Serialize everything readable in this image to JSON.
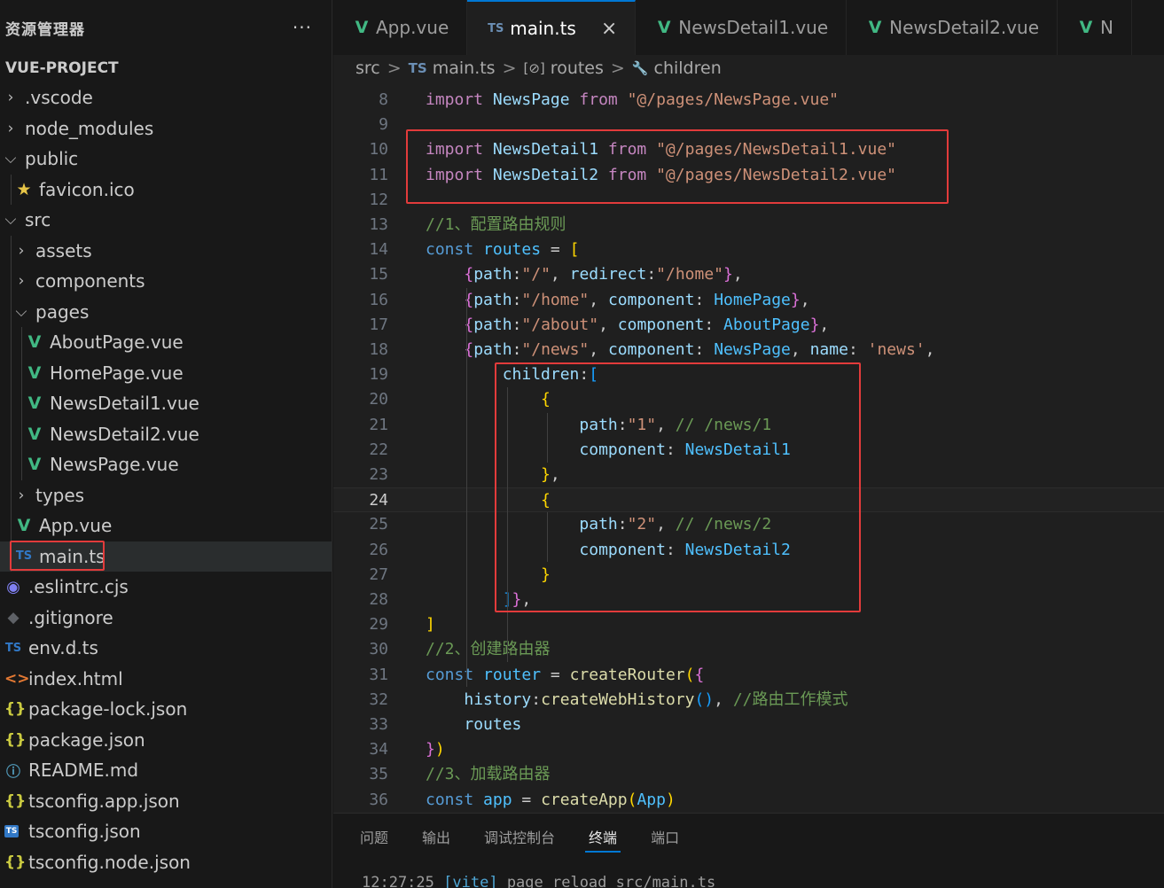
{
  "sidebar": {
    "title": "资源管理器",
    "more": "···",
    "project": "VUE-PROJECT",
    "items": [
      {
        "label": ".vscode",
        "depth": 0,
        "kind": "folder",
        "open": false
      },
      {
        "label": "node_modules",
        "depth": 0,
        "kind": "folder",
        "open": false
      },
      {
        "label": "public",
        "depth": 0,
        "kind": "folder",
        "open": true
      },
      {
        "label": "favicon.ico",
        "depth": 1,
        "kind": "file",
        "icon": "star"
      },
      {
        "label": "src",
        "depth": 0,
        "kind": "folder",
        "open": true
      },
      {
        "label": "assets",
        "depth": 1,
        "kind": "folder",
        "open": false
      },
      {
        "label": "components",
        "depth": 1,
        "kind": "folder",
        "open": false
      },
      {
        "label": "pages",
        "depth": 1,
        "kind": "folder",
        "open": true
      },
      {
        "label": "AboutPage.vue",
        "depth": 2,
        "kind": "file",
        "icon": "vue"
      },
      {
        "label": "HomePage.vue",
        "depth": 2,
        "kind": "file",
        "icon": "vue"
      },
      {
        "label": "NewsDetail1.vue",
        "depth": 2,
        "kind": "file",
        "icon": "vue"
      },
      {
        "label": "NewsDetail2.vue",
        "depth": 2,
        "kind": "file",
        "icon": "vue"
      },
      {
        "label": "NewsPage.vue",
        "depth": 2,
        "kind": "file",
        "icon": "vue"
      },
      {
        "label": "types",
        "depth": 1,
        "kind": "folder",
        "open": false
      },
      {
        "label": "App.vue",
        "depth": 1,
        "kind": "file",
        "icon": "vue"
      },
      {
        "label": "main.ts",
        "depth": 1,
        "kind": "file",
        "icon": "ts",
        "selected": true
      },
      {
        "label": ".eslintrc.cjs",
        "depth": 0,
        "kind": "file",
        "icon": "eslint"
      },
      {
        "label": ".gitignore",
        "depth": 0,
        "kind": "file",
        "icon": "git"
      },
      {
        "label": "env.d.ts",
        "depth": 0,
        "kind": "file",
        "icon": "ts"
      },
      {
        "label": "index.html",
        "depth": 0,
        "kind": "file",
        "icon": "html"
      },
      {
        "label": "package-lock.json",
        "depth": 0,
        "kind": "file",
        "icon": "json"
      },
      {
        "label": "package.json",
        "depth": 0,
        "kind": "file",
        "icon": "json"
      },
      {
        "label": "README.md",
        "depth": 0,
        "kind": "file",
        "icon": "info"
      },
      {
        "label": "tsconfig.app.json",
        "depth": 0,
        "kind": "file",
        "icon": "json"
      },
      {
        "label": "tsconfig.json",
        "depth": 0,
        "kind": "file",
        "icon": "tsconf"
      },
      {
        "label": "tsconfig.node.json",
        "depth": 0,
        "kind": "file",
        "icon": "json"
      }
    ]
  },
  "icons": {
    "vue": "V",
    "ts": "TS",
    "json": "{}",
    "html": "<>",
    "star": "★",
    "eslint": "◉",
    "git": "◆",
    "info": "ⓘ",
    "tsconf": "TS"
  },
  "tabs": [
    {
      "label": "App.vue",
      "icon": "vue",
      "active": false
    },
    {
      "label": "main.ts",
      "icon": "ts",
      "active": true
    },
    {
      "label": "NewsDetail1.vue",
      "icon": "vue",
      "active": false
    },
    {
      "label": "NewsDetail2.vue",
      "icon": "vue",
      "active": false
    },
    {
      "label": "N",
      "icon": "vue",
      "active": false
    }
  ],
  "tab_close": "×",
  "breadcrumb": {
    "src": "src",
    "file_icon": "TS",
    "file": "main.ts",
    "routes_icon": "[⊘]",
    "routes": "routes",
    "children_icon": "🔧",
    "children": "children",
    "sep": ">"
  },
  "code": {
    "current_line": 24,
    "lines": [
      {
        "n": 8,
        "t": [
          [
            "imp",
            "import "
          ],
          [
            "ident",
            "NewsPage "
          ],
          [
            "imp",
            "from "
          ],
          [
            "str",
            "\"@/pages/NewsPage.vue\""
          ]
        ]
      },
      {
        "n": 9,
        "t": []
      },
      {
        "n": 10,
        "t": [
          [
            "imp",
            "import "
          ],
          [
            "ident",
            "NewsDetail1 "
          ],
          [
            "imp",
            "from "
          ],
          [
            "str",
            "\"@/pages/NewsDetail1.vue\""
          ]
        ]
      },
      {
        "n": 11,
        "t": [
          [
            "imp",
            "import "
          ],
          [
            "ident",
            "NewsDetail2 "
          ],
          [
            "imp",
            "from "
          ],
          [
            "str",
            "\"@/pages/NewsDetail2.vue\""
          ]
        ]
      },
      {
        "n": 12,
        "t": []
      },
      {
        "n": 13,
        "t": [
          [
            "com",
            "//1、配置路由规则"
          ]
        ]
      },
      {
        "n": 14,
        "t": [
          [
            "kw",
            "const "
          ],
          [
            "var",
            "routes "
          ],
          [
            "",
            "= "
          ],
          [
            "b1",
            "["
          ]
        ]
      },
      {
        "n": 15,
        "t": [
          [
            "",
            "    "
          ],
          [
            "b2",
            "{"
          ],
          [
            "ident",
            "path"
          ],
          [
            "",
            ":"
          ],
          [
            "str",
            "\"/\""
          ],
          [
            "",
            ", "
          ],
          [
            "ident",
            "redirect"
          ],
          [
            "",
            ":"
          ],
          [
            "str",
            "\"/home\""
          ],
          [
            "b2",
            "}"
          ],
          [
            "",
            ","
          ]
        ]
      },
      {
        "n": 16,
        "t": [
          [
            "",
            "    "
          ],
          [
            "b2",
            "{"
          ],
          [
            "ident",
            "path"
          ],
          [
            "",
            ":"
          ],
          [
            "str",
            "\"/home\""
          ],
          [
            "",
            ", "
          ],
          [
            "ident",
            "component"
          ],
          [
            "",
            ": "
          ],
          [
            "var",
            "HomePage"
          ],
          [
            "b2",
            "}"
          ],
          [
            "",
            ","
          ]
        ]
      },
      {
        "n": 17,
        "t": [
          [
            "",
            "    "
          ],
          [
            "b2",
            "{"
          ],
          [
            "ident",
            "path"
          ],
          [
            "",
            ":"
          ],
          [
            "str",
            "\"/about\""
          ],
          [
            "",
            ", "
          ],
          [
            "ident",
            "component"
          ],
          [
            "",
            ": "
          ],
          [
            "var",
            "AboutPage"
          ],
          [
            "b2",
            "}"
          ],
          [
            "",
            ","
          ]
        ]
      },
      {
        "n": 18,
        "t": [
          [
            "",
            "    "
          ],
          [
            "b2",
            "{"
          ],
          [
            "ident",
            "path"
          ],
          [
            "",
            ":"
          ],
          [
            "str",
            "\"/news\""
          ],
          [
            "",
            ", "
          ],
          [
            "ident",
            "component"
          ],
          [
            "",
            ": "
          ],
          [
            "var",
            "NewsPage"
          ],
          [
            "",
            ", "
          ],
          [
            "ident",
            "name"
          ],
          [
            "",
            ": "
          ],
          [
            "str",
            "'news'"
          ],
          [
            "",
            ","
          ]
        ]
      },
      {
        "n": 19,
        "t": [
          [
            "",
            "        "
          ],
          [
            "ident",
            "children"
          ],
          [
            "",
            ":"
          ],
          [
            "b3",
            "["
          ]
        ]
      },
      {
        "n": 20,
        "t": [
          [
            "",
            "            "
          ],
          [
            "b1",
            "{"
          ]
        ]
      },
      {
        "n": 21,
        "t": [
          [
            "",
            "                "
          ],
          [
            "ident",
            "path"
          ],
          [
            "",
            ":"
          ],
          [
            "str",
            "\"1\""
          ],
          [
            "",
            ", "
          ],
          [
            "com",
            "// /news/1"
          ]
        ]
      },
      {
        "n": 22,
        "t": [
          [
            "",
            "                "
          ],
          [
            "ident",
            "component"
          ],
          [
            "",
            ": "
          ],
          [
            "var",
            "NewsDetail1"
          ]
        ]
      },
      {
        "n": 23,
        "t": [
          [
            "",
            "            "
          ],
          [
            "b1",
            "}"
          ],
          [
            "",
            ","
          ]
        ]
      },
      {
        "n": 24,
        "t": [
          [
            "",
            "            "
          ],
          [
            "b1",
            "{"
          ]
        ]
      },
      {
        "n": 25,
        "t": [
          [
            "",
            "                "
          ],
          [
            "ident",
            "path"
          ],
          [
            "",
            ":"
          ],
          [
            "str",
            "\"2\""
          ],
          [
            "",
            ", "
          ],
          [
            "com",
            "// /news/2"
          ]
        ]
      },
      {
        "n": 26,
        "t": [
          [
            "",
            "                "
          ],
          [
            "ident",
            "component"
          ],
          [
            "",
            ": "
          ],
          [
            "var",
            "NewsDetail2"
          ]
        ]
      },
      {
        "n": 27,
        "t": [
          [
            "",
            "            "
          ],
          [
            "b1",
            "}"
          ]
        ]
      },
      {
        "n": 28,
        "t": [
          [
            "",
            "        "
          ],
          [
            "b3",
            "]"
          ],
          [
            "b2",
            "}"
          ],
          [
            "",
            ","
          ]
        ]
      },
      {
        "n": 29,
        "t": [
          [
            "b1",
            "]"
          ]
        ]
      },
      {
        "n": 30,
        "t": [
          [
            "com",
            "//2、创建路由器"
          ]
        ]
      },
      {
        "n": 31,
        "t": [
          [
            "kw",
            "const "
          ],
          [
            "var",
            "router "
          ],
          [
            "",
            "= "
          ],
          [
            "fn",
            "createRouter"
          ],
          [
            "b1",
            "("
          ],
          [
            "b2",
            "{"
          ]
        ]
      },
      {
        "n": 32,
        "t": [
          [
            "",
            "    "
          ],
          [
            "ident",
            "history"
          ],
          [
            "",
            ":"
          ],
          [
            "fn",
            "createWebHistory"
          ],
          [
            "b3",
            "()"
          ],
          [
            "",
            ", "
          ],
          [
            "com",
            "//路由工作模式"
          ]
        ]
      },
      {
        "n": 33,
        "t": [
          [
            "",
            "    "
          ],
          [
            "ident",
            "routes"
          ]
        ]
      },
      {
        "n": 34,
        "t": [
          [
            "b2",
            "}"
          ],
          [
            "b1",
            ")"
          ]
        ]
      },
      {
        "n": 35,
        "t": [
          [
            "com",
            "//3、加载路由器"
          ]
        ]
      },
      {
        "n": 36,
        "t": [
          [
            "kw",
            "const "
          ],
          [
            "var",
            "app "
          ],
          [
            "",
            "= "
          ],
          [
            "fn",
            "createApp"
          ],
          [
            "b1",
            "("
          ],
          [
            "var",
            "App"
          ],
          [
            "b1",
            ")"
          ]
        ]
      }
    ]
  },
  "panel": {
    "tabs": [
      "问题",
      "输出",
      "调试控制台",
      "终端",
      "端口"
    ],
    "active_tab": "终端",
    "terminal": {
      "time": "12:27:25",
      "tag": "[vite]",
      "message": "page reload src/main.ts"
    }
  },
  "colors": {
    "accent": "#0078d4",
    "highlight_box": "#e23b3b",
    "vue": "#41b883",
    "ts": "#3178c6"
  }
}
